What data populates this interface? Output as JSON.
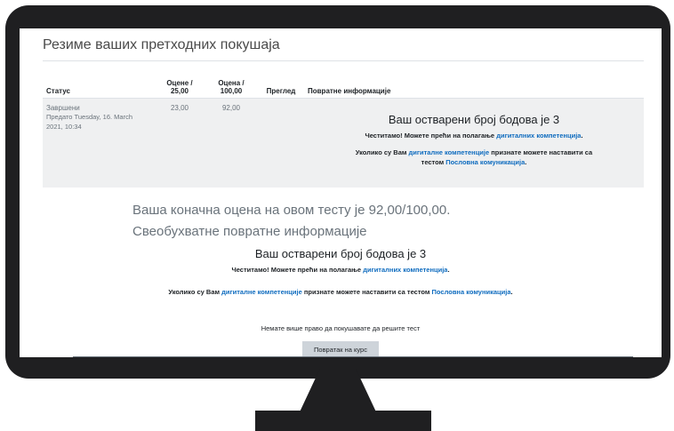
{
  "section_title": "Резиме ваших претходних покушаја",
  "table": {
    "headers": {
      "status": "Статус",
      "marks_line1": "Оцене /",
      "marks_line2": "25,00",
      "grade_line1": "Оцена /",
      "grade_line2": "100,00",
      "review": "Преглед",
      "feedback": "Повратне информације"
    },
    "row": {
      "status": "Завршени",
      "submitted_line1": "Предато Tuesday, 16. March",
      "submitted_line2": "2021, 10:34",
      "marks": "23,00",
      "grade": "92,00",
      "feedback_title": "Ваш остварени број бодова је 3",
      "feedback_l1_text": "Честитамо! Можете прећи на полагање ",
      "feedback_l1_link": "дигиталних компетенција",
      "feedback_l1_end": ".",
      "feedback_l2_text": "Уколико су Вам ",
      "feedback_l2_link1": "дигиталне компетенције",
      "feedback_l2_mid": " признате можете наставити са",
      "feedback_l3_text": "тестом ",
      "feedback_l3_link": "Пословна комуникација",
      "feedback_l3_end": "."
    }
  },
  "final_grade": "Ваша коначна оцена на овом тесту је 92,00/100,00.",
  "overall_feedback_heading": "Свеобухватне повратне информације",
  "overall": {
    "title": "Ваш остварени број бодова је 3",
    "line1_text": "Честитамо! Можете прећи на полагање ",
    "line1_link": "дигиталних компетенција",
    "line1_end": ".",
    "line2_text": "Уколико су Вам ",
    "line2_link1": "дигиталне компетенције",
    "line2_mid": " признате можете наставити са тестом ",
    "line2_link2": "Пословна комуникација",
    "line2_end": "."
  },
  "no_more_attempts": "Немате више право да покушавате да решите тест",
  "back_button": "Повратак на курс",
  "colors": {
    "link": "#0f6cbf",
    "row_bg": "#eff0f1",
    "button_bg": "#ced4da",
    "monitor": "#1f1f21"
  }
}
